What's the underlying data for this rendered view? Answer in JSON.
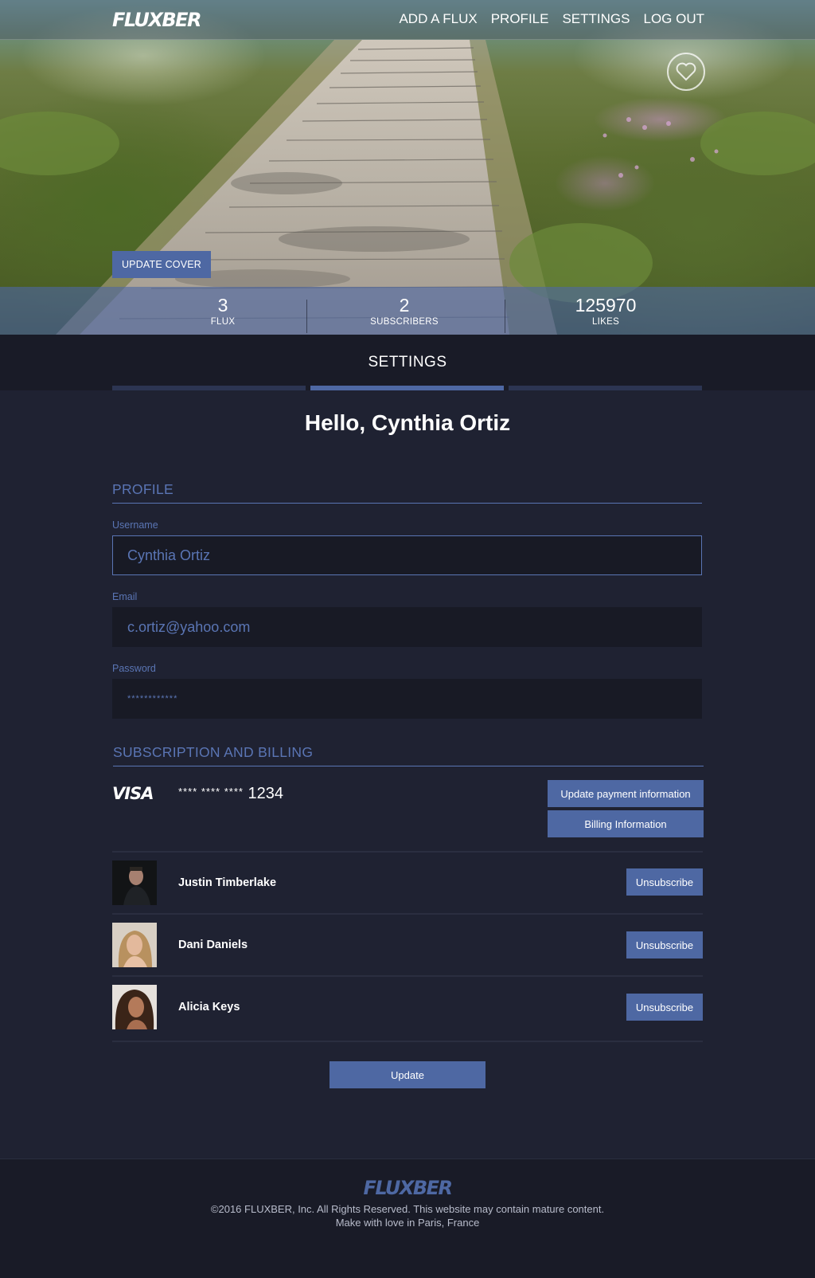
{
  "brand": {
    "logo": "FLUXBER",
    "accent": "#4e68a3",
    "background": "#1f2232"
  },
  "nav": {
    "items": [
      "ADD A FLUX",
      "PROFILE",
      "SETTINGS",
      "LOG OUT"
    ]
  },
  "hero": {
    "favorite_icon": "heart-icon",
    "update_cover_label": "UPDATE COVER"
  },
  "stats": {
    "flux": {
      "value": "3",
      "label": "FLUX"
    },
    "subscribers": {
      "value": "2",
      "label": "SUBSCRIBERS"
    },
    "likes": {
      "value": "125970",
      "label": "LIKES"
    }
  },
  "settings": {
    "title": "SETTINGS",
    "active_tab": 2
  },
  "greeting": "Hello, Cynthia Ortiz",
  "profile": {
    "section_title": "PROFILE",
    "username_label": "Username",
    "username_value": "Cynthia Ortiz",
    "email_label": "Email",
    "email_value": "c.ortiz@yahoo.com",
    "password_label": "Password",
    "password_value": "************"
  },
  "billing": {
    "section_title": "SUBSCRIPTION AND BILLING",
    "card_brand": "VISA",
    "card_mask": "**** **** ****",
    "card_last4": "1234",
    "update_payment_label": "Update payment information",
    "billing_info_label": "Billing Information"
  },
  "subscriptions": [
    {
      "name": "Justin Timberlake",
      "action": "Unsubscribe"
    },
    {
      "name": "Dani Daniels",
      "action": "Unsubscribe"
    },
    {
      "name": "Alicia Keys",
      "action": "Unsubscribe"
    }
  ],
  "update_label": "Update",
  "footer": {
    "logo": "FLUXBER",
    "line1": "©2016 FLUXBER, Inc. All Rights Reserved. This website may contain mature content.",
    "line2": "Make with love in Paris, France"
  }
}
